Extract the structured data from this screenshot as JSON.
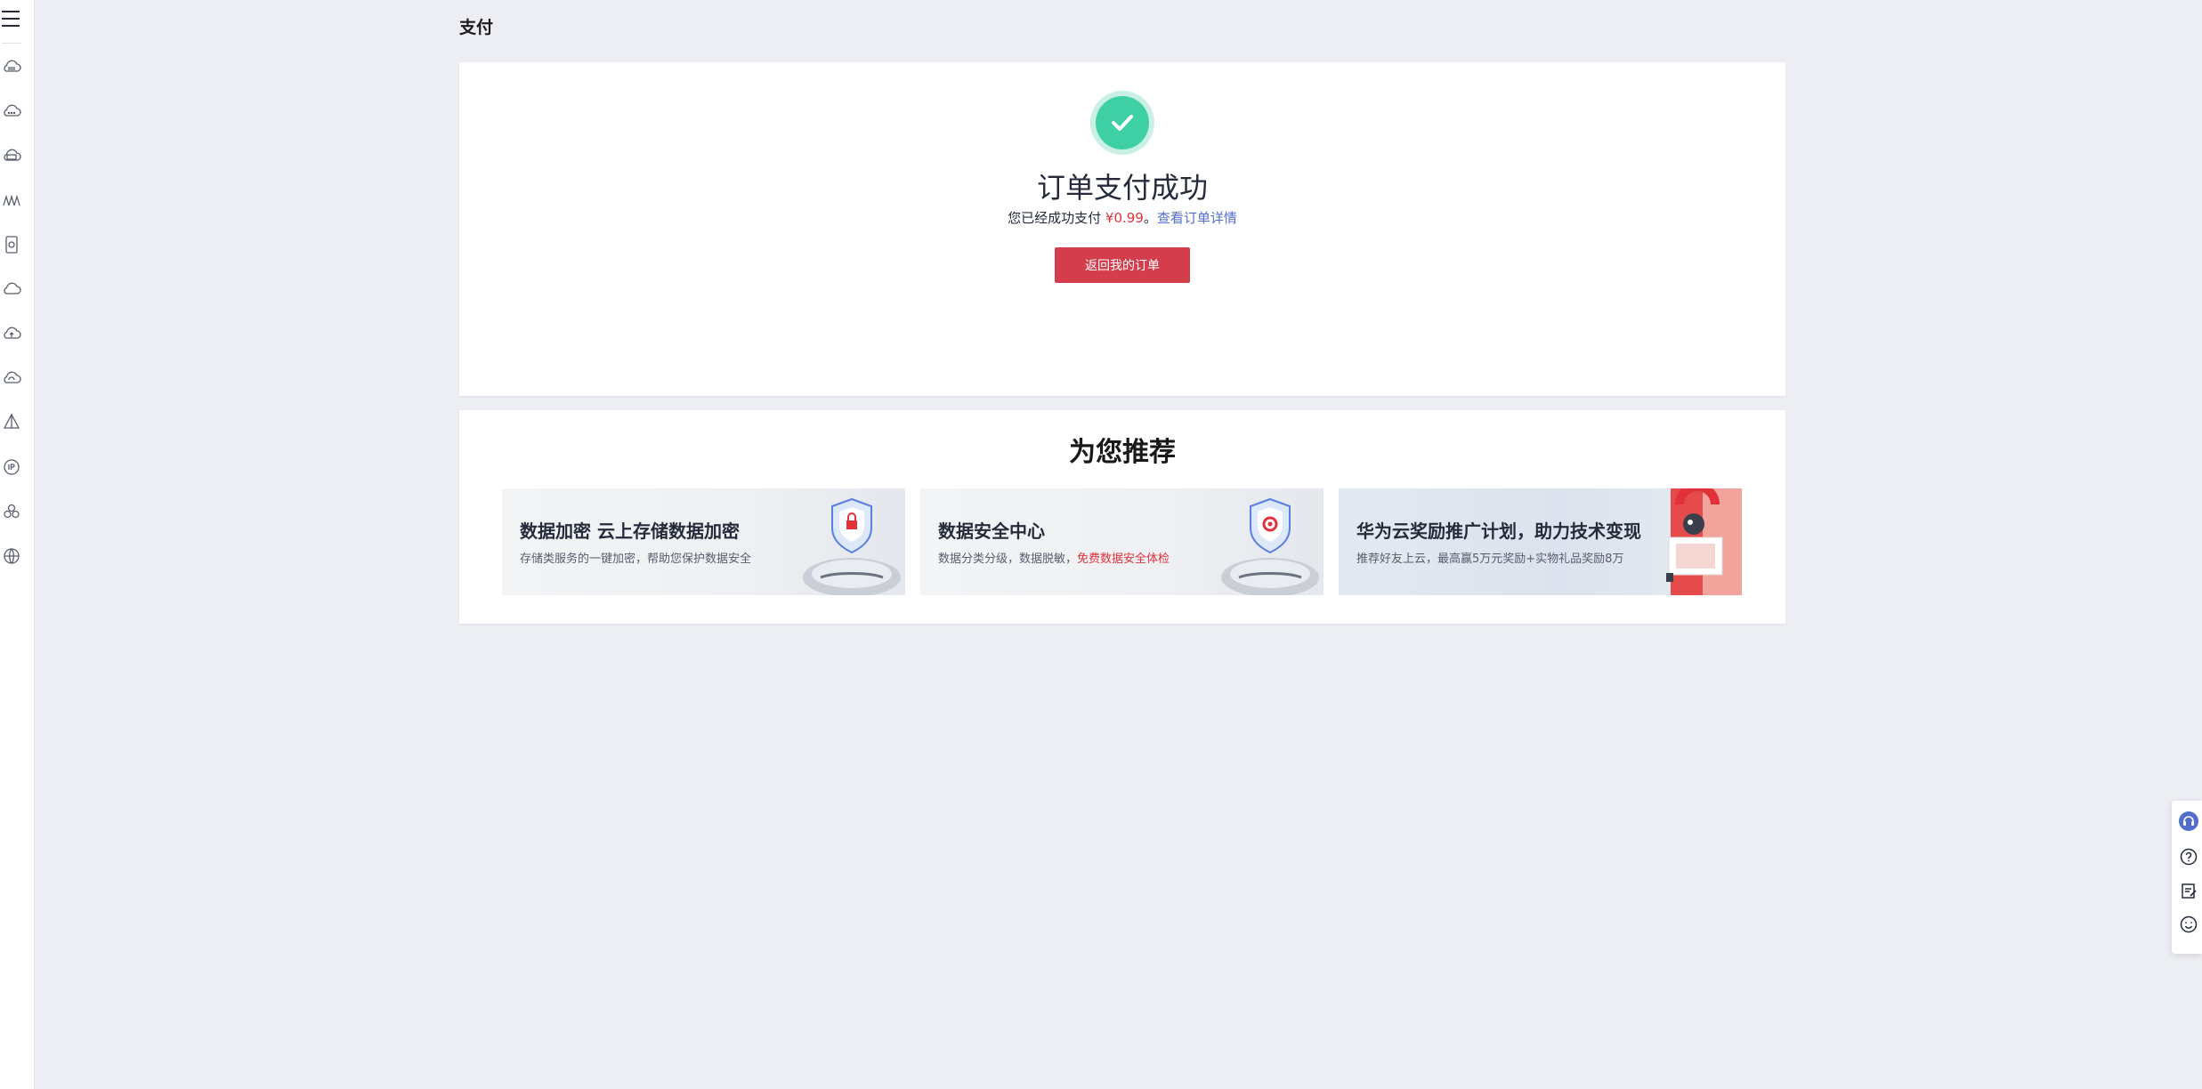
{
  "page": {
    "title": "支付"
  },
  "sidebar": {
    "menu_icon": "menu-icon",
    "items": [
      {
        "icon": "cloud-server-icon"
      },
      {
        "icon": "cloud-dots-icon"
      },
      {
        "icon": "cloud-storage-icon"
      },
      {
        "icon": "network-icon"
      },
      {
        "icon": "mobile-app-icon"
      },
      {
        "icon": "cloud-icon"
      },
      {
        "icon": "cloud-upload-icon"
      },
      {
        "icon": "cloud-sync-icon"
      },
      {
        "icon": "pyramid-icon"
      },
      {
        "icon": "ip-icon"
      },
      {
        "icon": "cluster-icon"
      },
      {
        "icon": "globe-icon"
      }
    ]
  },
  "success": {
    "icon": "check-icon",
    "heading": "订单支付成功",
    "message_prefix": "您已经成功支付",
    "amount": "¥0.99",
    "message_sep": "。",
    "detail_link": "查看订单详情",
    "back_button": "返回我的订单"
  },
  "recommend": {
    "title": "为您推荐",
    "banners": [
      {
        "title": "数据加密 云上存储数据加密",
        "desc": "存储类服务的一键加密，帮助您保护数据安全",
        "desc_highlight": ""
      },
      {
        "title": "数据安全中心",
        "desc": "数据分类分级，数据脱敏，",
        "desc_highlight": "免费数据安全体检"
      },
      {
        "title": "华为云奖励推广计划，助力技术变现",
        "desc": "推荐好友上云，最高赢5万元奖励+实物礼品奖励8万",
        "desc_highlight": ""
      }
    ]
  },
  "float_toolbar": {
    "items": [
      {
        "icon": "headset-icon"
      },
      {
        "icon": "help-icon"
      },
      {
        "icon": "edit-note-icon"
      },
      {
        "icon": "smile-icon"
      }
    ]
  },
  "colors": {
    "accent_red": "#d43d4c",
    "success_green": "#3fcfa4",
    "link_blue": "#526ecc",
    "amount_red": "#e1313b"
  }
}
